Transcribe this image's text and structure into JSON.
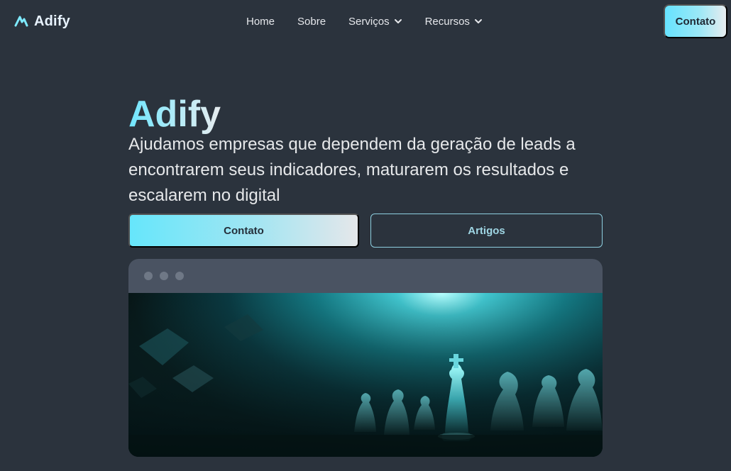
{
  "brand": {
    "name": "Adify",
    "logo_icon": "adify-logo-icon"
  },
  "nav": {
    "items": [
      {
        "label": "Home"
      },
      {
        "label": "Sobre"
      },
      {
        "label": "Serviços",
        "icon": "chevron-down-icon"
      },
      {
        "label": "Recursos",
        "icon": "chevron-down-icon"
      }
    ],
    "cta_label": "Contato"
  },
  "hero": {
    "title": "Adify",
    "subtitle": "Ajudamos empresas que dependem da geração de leads a encontrarem seus indicadores, maturarem os resultados e escalarem no digital",
    "primary_button": "Contato",
    "secondary_button": "Artigos"
  },
  "colors": {
    "background": "#2b333d",
    "accent": "#66e3ff",
    "button_gradient_end": "#e7ecef",
    "window_bar": "#4a5362"
  },
  "window": {
    "dots": 3,
    "image": "chess-pieces-teal-spotlight"
  }
}
